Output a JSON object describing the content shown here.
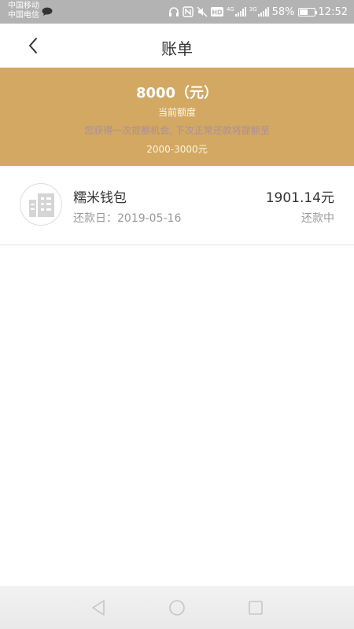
{
  "status_bar": {
    "carrier1": "中国移动",
    "carrier2": "中国电信",
    "network1": "4G",
    "network2": "3G",
    "battery": "58%",
    "battery_level": 0.58,
    "time": "12:52"
  },
  "nav": {
    "title": "账单"
  },
  "banner": {
    "amount": "8000（元）",
    "amount_label": "当前额度",
    "tip_line1": "您获得一次提额机会, 下次正常还款将提额至",
    "tip_line2": "2000-3000元"
  },
  "bills": [
    {
      "name": "糯米钱包",
      "date": "还款日：2019-05-16",
      "amount": "1901.14元",
      "status": "还款中"
    }
  ],
  "colors": {
    "banner": "#d2a863",
    "status_bar": "#b3b3b3"
  }
}
